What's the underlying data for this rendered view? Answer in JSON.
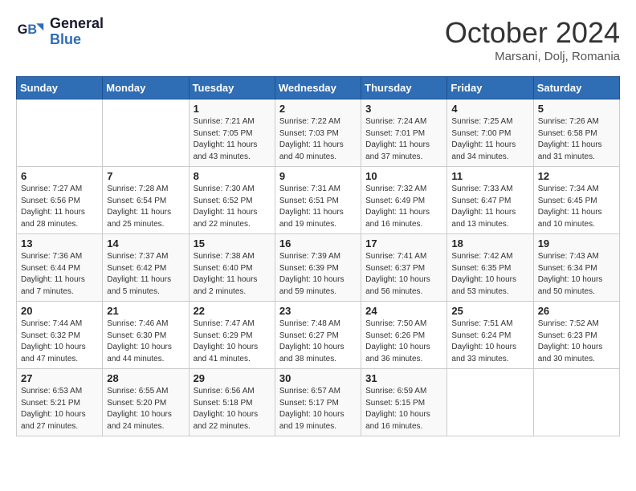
{
  "header": {
    "logo_line1": "General",
    "logo_line2": "Blue",
    "title": "October 2024",
    "subtitle": "Marsani, Dolj, Romania"
  },
  "days_of_week": [
    "Sunday",
    "Monday",
    "Tuesday",
    "Wednesday",
    "Thursday",
    "Friday",
    "Saturday"
  ],
  "weeks": [
    [
      {
        "day": "",
        "info": ""
      },
      {
        "day": "",
        "info": ""
      },
      {
        "day": "1",
        "info": "Sunrise: 7:21 AM\nSunset: 7:05 PM\nDaylight: 11 hours\nand 43 minutes."
      },
      {
        "day": "2",
        "info": "Sunrise: 7:22 AM\nSunset: 7:03 PM\nDaylight: 11 hours\nand 40 minutes."
      },
      {
        "day": "3",
        "info": "Sunrise: 7:24 AM\nSunset: 7:01 PM\nDaylight: 11 hours\nand 37 minutes."
      },
      {
        "day": "4",
        "info": "Sunrise: 7:25 AM\nSunset: 7:00 PM\nDaylight: 11 hours\nand 34 minutes."
      },
      {
        "day": "5",
        "info": "Sunrise: 7:26 AM\nSunset: 6:58 PM\nDaylight: 11 hours\nand 31 minutes."
      }
    ],
    [
      {
        "day": "6",
        "info": "Sunrise: 7:27 AM\nSunset: 6:56 PM\nDaylight: 11 hours\nand 28 minutes."
      },
      {
        "day": "7",
        "info": "Sunrise: 7:28 AM\nSunset: 6:54 PM\nDaylight: 11 hours\nand 25 minutes."
      },
      {
        "day": "8",
        "info": "Sunrise: 7:30 AM\nSunset: 6:52 PM\nDaylight: 11 hours\nand 22 minutes."
      },
      {
        "day": "9",
        "info": "Sunrise: 7:31 AM\nSunset: 6:51 PM\nDaylight: 11 hours\nand 19 minutes."
      },
      {
        "day": "10",
        "info": "Sunrise: 7:32 AM\nSunset: 6:49 PM\nDaylight: 11 hours\nand 16 minutes."
      },
      {
        "day": "11",
        "info": "Sunrise: 7:33 AM\nSunset: 6:47 PM\nDaylight: 11 hours\nand 13 minutes."
      },
      {
        "day": "12",
        "info": "Sunrise: 7:34 AM\nSunset: 6:45 PM\nDaylight: 11 hours\nand 10 minutes."
      }
    ],
    [
      {
        "day": "13",
        "info": "Sunrise: 7:36 AM\nSunset: 6:44 PM\nDaylight: 11 hours\nand 7 minutes."
      },
      {
        "day": "14",
        "info": "Sunrise: 7:37 AM\nSunset: 6:42 PM\nDaylight: 11 hours\nand 5 minutes."
      },
      {
        "day": "15",
        "info": "Sunrise: 7:38 AM\nSunset: 6:40 PM\nDaylight: 11 hours\nand 2 minutes."
      },
      {
        "day": "16",
        "info": "Sunrise: 7:39 AM\nSunset: 6:39 PM\nDaylight: 10 hours\nand 59 minutes."
      },
      {
        "day": "17",
        "info": "Sunrise: 7:41 AM\nSunset: 6:37 PM\nDaylight: 10 hours\nand 56 minutes."
      },
      {
        "day": "18",
        "info": "Sunrise: 7:42 AM\nSunset: 6:35 PM\nDaylight: 10 hours\nand 53 minutes."
      },
      {
        "day": "19",
        "info": "Sunrise: 7:43 AM\nSunset: 6:34 PM\nDaylight: 10 hours\nand 50 minutes."
      }
    ],
    [
      {
        "day": "20",
        "info": "Sunrise: 7:44 AM\nSunset: 6:32 PM\nDaylight: 10 hours\nand 47 minutes."
      },
      {
        "day": "21",
        "info": "Sunrise: 7:46 AM\nSunset: 6:30 PM\nDaylight: 10 hours\nand 44 minutes."
      },
      {
        "day": "22",
        "info": "Sunrise: 7:47 AM\nSunset: 6:29 PM\nDaylight: 10 hours\nand 41 minutes."
      },
      {
        "day": "23",
        "info": "Sunrise: 7:48 AM\nSunset: 6:27 PM\nDaylight: 10 hours\nand 38 minutes."
      },
      {
        "day": "24",
        "info": "Sunrise: 7:50 AM\nSunset: 6:26 PM\nDaylight: 10 hours\nand 36 minutes."
      },
      {
        "day": "25",
        "info": "Sunrise: 7:51 AM\nSunset: 6:24 PM\nDaylight: 10 hours\nand 33 minutes."
      },
      {
        "day": "26",
        "info": "Sunrise: 7:52 AM\nSunset: 6:23 PM\nDaylight: 10 hours\nand 30 minutes."
      }
    ],
    [
      {
        "day": "27",
        "info": "Sunrise: 6:53 AM\nSunset: 5:21 PM\nDaylight: 10 hours\nand 27 minutes."
      },
      {
        "day": "28",
        "info": "Sunrise: 6:55 AM\nSunset: 5:20 PM\nDaylight: 10 hours\nand 24 minutes."
      },
      {
        "day": "29",
        "info": "Sunrise: 6:56 AM\nSunset: 5:18 PM\nDaylight: 10 hours\nand 22 minutes."
      },
      {
        "day": "30",
        "info": "Sunrise: 6:57 AM\nSunset: 5:17 PM\nDaylight: 10 hours\nand 19 minutes."
      },
      {
        "day": "31",
        "info": "Sunrise: 6:59 AM\nSunset: 5:15 PM\nDaylight: 10 hours\nand 16 minutes."
      },
      {
        "day": "",
        "info": ""
      },
      {
        "day": "",
        "info": ""
      }
    ]
  ]
}
